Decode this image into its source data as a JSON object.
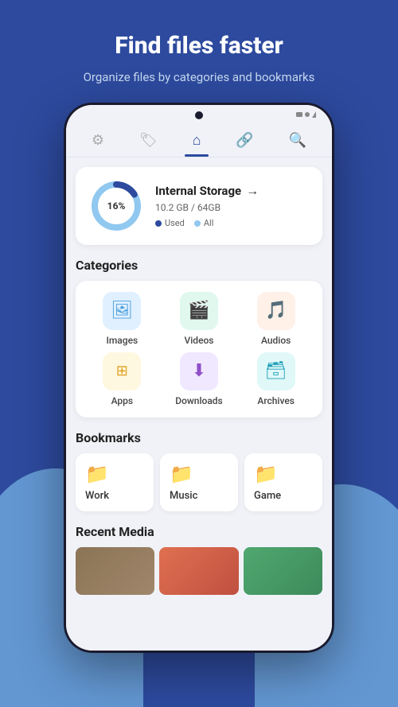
{
  "header": {
    "title": "Find files faster",
    "subtitle": "Organize files by categories and bookmarks"
  },
  "status_bar": {
    "camera": "camera-dot"
  },
  "nav": {
    "tabs": [
      {
        "id": "settings",
        "icon": "⚙",
        "label": "Settings",
        "active": false
      },
      {
        "id": "bookmarks",
        "icon": "🏷",
        "label": "Bookmarks",
        "active": false
      },
      {
        "id": "home",
        "icon": "⌂",
        "label": "Home",
        "active": true
      },
      {
        "id": "link",
        "icon": "🔗",
        "label": "Link",
        "active": false
      },
      {
        "id": "search",
        "icon": "🔍",
        "label": "Search",
        "active": false
      }
    ]
  },
  "storage": {
    "title": "Internal Storage",
    "used_percent": 16,
    "used_label": "16%",
    "size_text": "10.2 GB / 64GB",
    "legend_used": "Used",
    "legend_all": "All"
  },
  "categories": {
    "section_title": "Categories",
    "items": [
      {
        "id": "images",
        "label": "Images",
        "icon": "🖼",
        "color_class": "icon-images"
      },
      {
        "id": "videos",
        "label": "Videos",
        "icon": "🎬",
        "color_class": "icon-videos"
      },
      {
        "id": "audios",
        "label": "Audios",
        "icon": "🎵",
        "color_class": "icon-audios"
      },
      {
        "id": "apps",
        "label": "Apps",
        "icon": "⊞",
        "color_class": "icon-apps"
      },
      {
        "id": "downloads",
        "label": "Downloads",
        "icon": "⬇",
        "color_class": "icon-downloads"
      },
      {
        "id": "archives",
        "label": "Archives",
        "icon": "🗃",
        "color_class": "icon-archives"
      }
    ]
  },
  "bookmarks": {
    "section_title": "Bookmarks",
    "items": [
      {
        "id": "work",
        "label": "Work",
        "icon": "📁",
        "color": "#2d8aee"
      },
      {
        "id": "music",
        "label": "Music",
        "icon": "📁",
        "color": "#2d8aee"
      },
      {
        "id": "game",
        "label": "Game",
        "icon": "📁",
        "color": "#2d8aee"
      }
    ]
  },
  "recent_media": {
    "section_title": "Recent Media"
  }
}
